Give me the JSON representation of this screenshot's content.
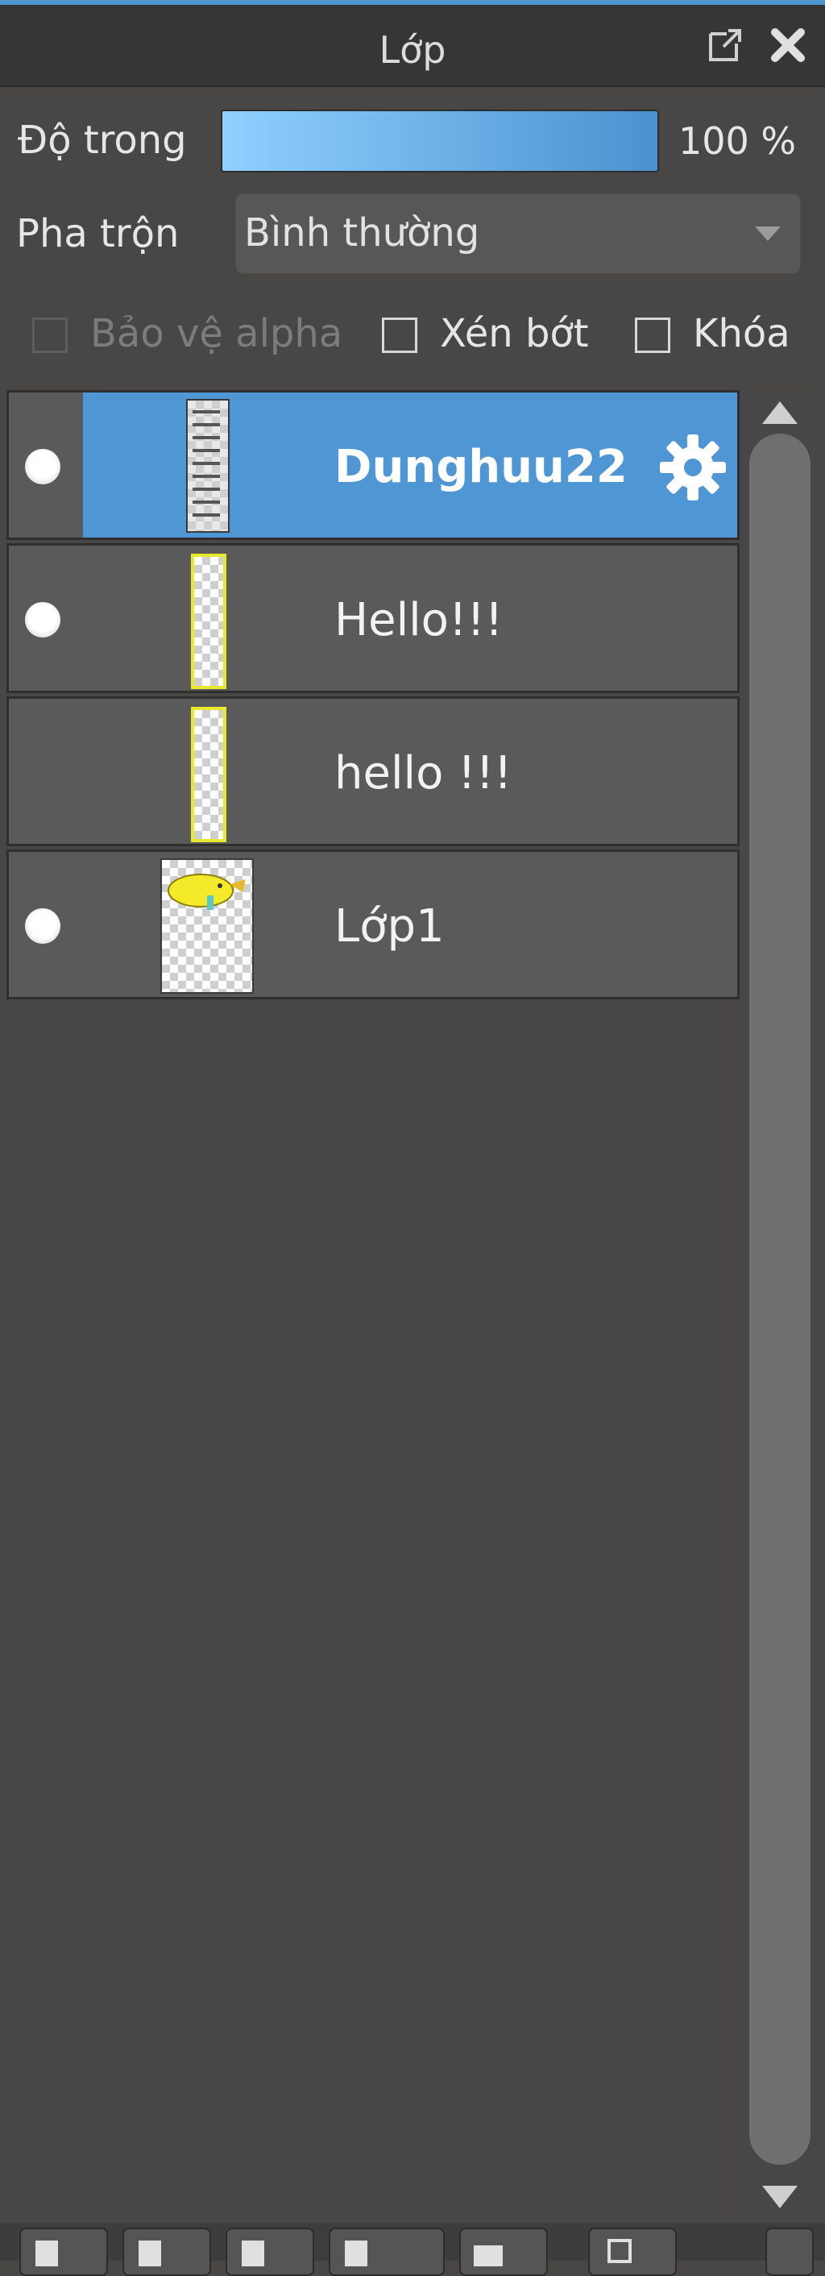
{
  "panel": {
    "title": "Lớp",
    "popout_icon": "popout-icon",
    "close_icon": "close-icon"
  },
  "opacity": {
    "label": "Độ trong",
    "value_text": "100 %",
    "value": 100
  },
  "blend": {
    "label": "Pha trộn",
    "value": "Bình thường"
  },
  "options": [
    {
      "label": "Bảo vệ alpha",
      "checked": false,
      "enabled": false
    },
    {
      "label": "Xén bớt",
      "checked": false,
      "enabled": true
    },
    {
      "label": "Khóa",
      "checked": false,
      "enabled": true
    }
  ],
  "layers": [
    {
      "name": "Dunghuu22",
      "visible": true,
      "selected": true
    },
    {
      "name": "Hello!!!",
      "visible": true,
      "selected": false
    },
    {
      "name": "hello !!!",
      "visible": false,
      "selected": false
    },
    {
      "name": "Lớp1",
      "visible": true,
      "selected": false
    }
  ],
  "colors": {
    "accent": "#4f96d4",
    "panel": "#484746",
    "row": "#5a5a5a"
  }
}
